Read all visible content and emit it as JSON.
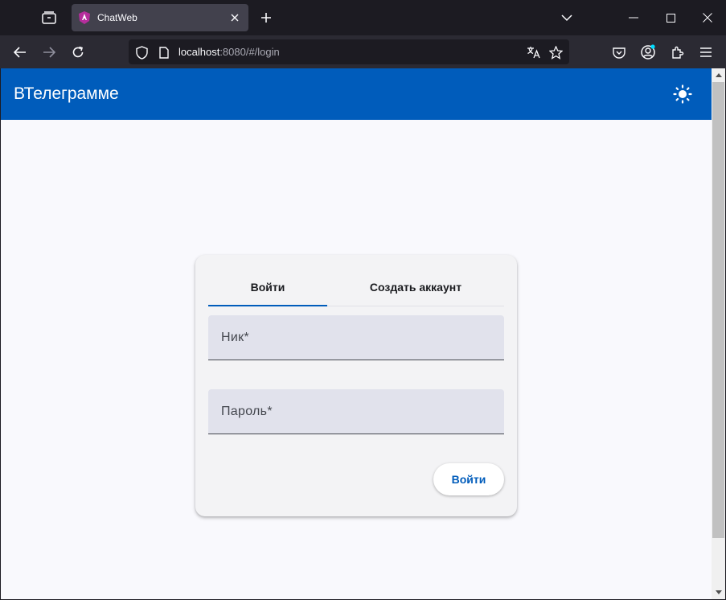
{
  "browser": {
    "tab": {
      "title": "ChatWeb"
    },
    "url": {
      "host": "localhost",
      "rest": ":8080/#/login"
    }
  },
  "app": {
    "title": "ВТелеграмме"
  },
  "login_card": {
    "tabs": [
      {
        "label": "Войти",
        "active": true
      },
      {
        "label": "Создать аккаунт",
        "active": false
      }
    ],
    "fields": {
      "nick": {
        "label": "Ник*",
        "value": ""
      },
      "password": {
        "label": "Пароль*",
        "value": ""
      }
    },
    "submit_label": "Войти"
  },
  "colors": {
    "primary": "#005cbb",
    "field_bg": "#e1e2ec",
    "page_bg": "#f9f9fd",
    "card_bg": "#f3f3f5"
  },
  "icons": {
    "tab_list": "tab-list-icon",
    "favicon": "angular-icon",
    "theme_toggle": "sun-icon"
  }
}
